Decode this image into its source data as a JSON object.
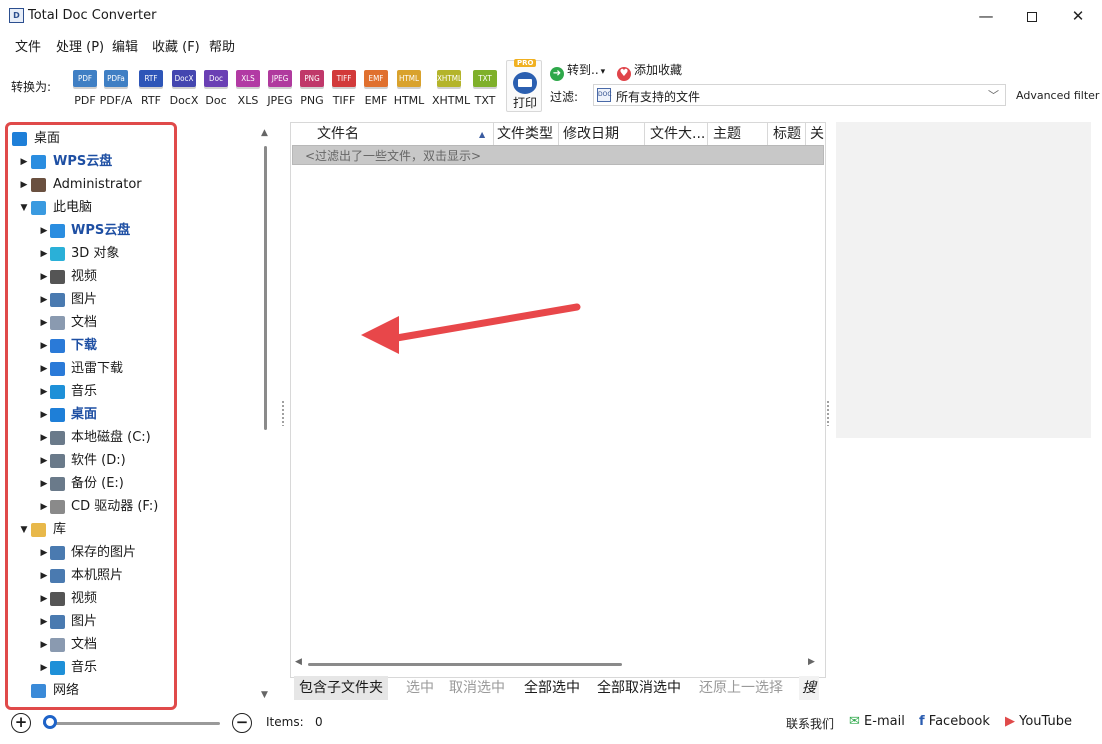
{
  "window": {
    "title": "Total Doc Converter"
  },
  "menu": [
    "文件",
    "处理 (P)",
    "编辑",
    "收藏 (F)",
    "帮助"
  ],
  "toolbar": {
    "convert_label": "转换为:",
    "formats": [
      {
        "label": "PDF",
        "icon_text": "PDF",
        "color": "#3f7fc4"
      },
      {
        "label": "PDF/A",
        "icon_text": "PDFa",
        "color": "#3f7fc4"
      },
      {
        "label": "RTF",
        "icon_text": "RTF",
        "color": "#2e56b8"
      },
      {
        "label": "DocX",
        "icon_text": "DocX",
        "color": "#4446b0"
      },
      {
        "label": "Doc",
        "icon_text": "Doc",
        "color": "#6a3fb4"
      },
      {
        "label": "XLS",
        "icon_text": "XLS",
        "color": "#b23aa4"
      },
      {
        "label": "JPEG",
        "icon_text": "JPEG",
        "color": "#b03a9e"
      },
      {
        "label": "PNG",
        "icon_text": "PNG",
        "color": "#c0386a"
      },
      {
        "label": "TIFF",
        "icon_text": "TIFF",
        "color": "#d23a3a"
      },
      {
        "label": "EMF",
        "icon_text": "EMF",
        "color": "#e0702e"
      },
      {
        "label": "HTML",
        "icon_text": "HTML",
        "color": "#d9a22c"
      },
      {
        "label": "XHTML",
        "icon_text": "XHTML",
        "color": "#b4b42a"
      },
      {
        "label": "TXT",
        "icon_text": "TXT",
        "color": "#7fb02a"
      }
    ],
    "print_label": "打印",
    "pro_badge": "PRO",
    "goto_label": "转到..",
    "goto_caret": "▾",
    "goto_icon_glyph": "➜",
    "favorite_label": "添加收藏",
    "favorite_icon_glyph": "♥",
    "filter_label": "过滤:",
    "filter_icon_text": "DOC",
    "filter_value": "所有支持的文件",
    "filter_arrow": "﹀",
    "advanced_filter": "Advanced filter"
  },
  "tree": [
    {
      "label": "桌面",
      "level": 0,
      "arrow": "",
      "icon": "desktop-icon",
      "color": "#1e7fd8",
      "bold": false
    },
    {
      "label": "WPS云盘",
      "level": 1,
      "arrow": "▶",
      "icon": "cloud-icon",
      "color": "#2a8de0",
      "bold": true
    },
    {
      "label": "Administrator",
      "level": 1,
      "arrow": "▶",
      "icon": "user-icon",
      "color": "#6a5040",
      "bold": false
    },
    {
      "label": "此电脑",
      "level": 1,
      "arrow": "▼",
      "icon": "computer-icon",
      "color": "#3a9ae0",
      "bold": false
    },
    {
      "label": "WPS云盘",
      "level": 2,
      "arrow": "▶",
      "icon": "cloud-icon",
      "color": "#2a8de0",
      "bold": true
    },
    {
      "label": "3D 对象",
      "level": 2,
      "arrow": "▶",
      "icon": "cube-icon",
      "color": "#2ab0d8",
      "bold": false
    },
    {
      "label": "视频",
      "level": 2,
      "arrow": "▶",
      "icon": "film-icon",
      "color": "#555555",
      "bold": false
    },
    {
      "label": "图片",
      "level": 2,
      "arrow": "▶",
      "icon": "picture-icon",
      "color": "#4a7ab0",
      "bold": false
    },
    {
      "label": "文档",
      "level": 2,
      "arrow": "▶",
      "icon": "document-icon",
      "color": "#8a9ab0",
      "bold": false
    },
    {
      "label": "下载",
      "level": 2,
      "arrow": "▶",
      "icon": "download-icon",
      "color": "#2a7ad8",
      "bold": true
    },
    {
      "label": "迅雷下载",
      "level": 2,
      "arrow": "▶",
      "icon": "thunder-icon",
      "color": "#2a7ad8",
      "bold": false
    },
    {
      "label": "音乐",
      "level": 2,
      "arrow": "▶",
      "icon": "music-icon",
      "color": "#1e90d8",
      "bold": false
    },
    {
      "label": "桌面",
      "level": 2,
      "arrow": "▶",
      "icon": "desktop-icon",
      "color": "#1e7fd8",
      "bold": true
    },
    {
      "label": "本地磁盘 (C:)",
      "level": 2,
      "arrow": "▶",
      "icon": "drive-c-icon",
      "color": "#6a7a8a",
      "bold": false
    },
    {
      "label": "软件 (D:)",
      "level": 2,
      "arrow": "▶",
      "icon": "drive-icon",
      "color": "#6a7a8a",
      "bold": false
    },
    {
      "label": "备份 (E:)",
      "level": 2,
      "arrow": "▶",
      "icon": "drive-icon",
      "color": "#6a7a8a",
      "bold": false
    },
    {
      "label": "CD 驱动器 (F:)",
      "level": 2,
      "arrow": "▶",
      "icon": "cd-drive-icon",
      "color": "#8a8a8a",
      "bold": false
    },
    {
      "label": "库",
      "level": 1,
      "arrow": "▼",
      "icon": "library-folder-icon",
      "color": "#e8b84a",
      "bold": false
    },
    {
      "label": "保存的图片",
      "level": 2,
      "arrow": "▶",
      "icon": "picture-icon",
      "color": "#4a7ab0",
      "bold": false
    },
    {
      "label": "本机照片",
      "level": 2,
      "arrow": "▶",
      "icon": "picture-icon",
      "color": "#4a7ab0",
      "bold": false
    },
    {
      "label": "视频",
      "level": 2,
      "arrow": "▶",
      "icon": "film-icon",
      "color": "#555555",
      "bold": false
    },
    {
      "label": "图片",
      "level": 2,
      "arrow": "▶",
      "icon": "picture-icon",
      "color": "#4a7ab0",
      "bold": false
    },
    {
      "label": "文档",
      "level": 2,
      "arrow": "▶",
      "icon": "document-icon",
      "color": "#8a9ab0",
      "bold": false
    },
    {
      "label": "音乐",
      "level": 2,
      "arrow": "▶",
      "icon": "music-icon",
      "color": "#1e90d8",
      "bold": false
    },
    {
      "label": "网络",
      "level": 1,
      "arrow": "",
      "icon": "network-icon",
      "color": "#3a8ad8",
      "bold": false
    }
  ],
  "file_list": {
    "columns": [
      "文件名",
      "文件类型",
      "修改日期",
      "文件大...",
      "主题",
      "标题",
      "关"
    ],
    "filtered_hint": "<过滤出了一些文件，双击显示>"
  },
  "actions": {
    "include_subfolders": "包含子文件夹",
    "select": "选中",
    "deselect": "取消选中",
    "select_all": "全部选中",
    "deselect_all": "全部取消选中",
    "restore_selection": "还原上一选择",
    "search_partial": "搜"
  },
  "status": {
    "zoom_level": 0.01,
    "zoom_in": "+",
    "zoom_out": "−",
    "items_label": "Items:",
    "items_count": "0",
    "contact": "联系我们",
    "email": "E-mail",
    "facebook": "Facebook",
    "youtube": "YouTube"
  },
  "colors": {
    "highlight_border": "#e04a4a",
    "annotation_arrow": "#e8474a",
    "accent": "#1e63c8"
  }
}
